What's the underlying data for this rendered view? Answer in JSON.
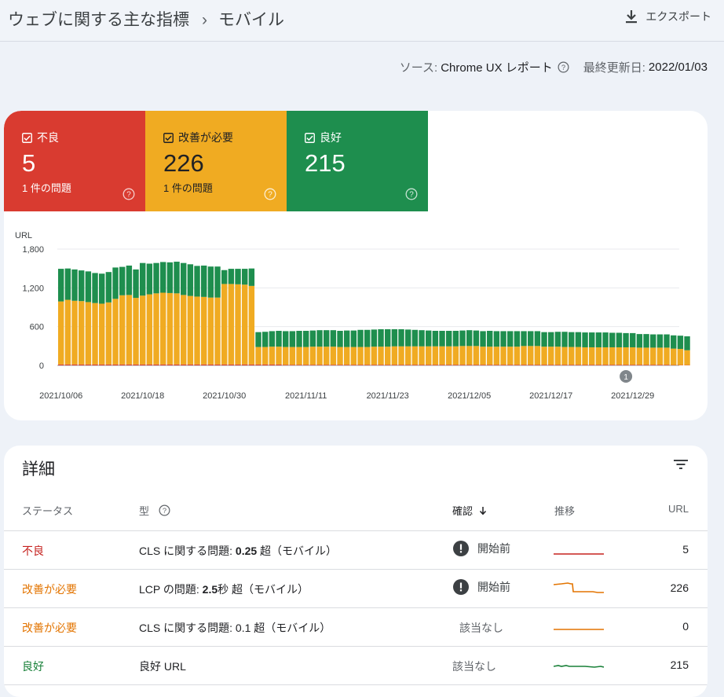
{
  "breadcrumb": {
    "parent": "ウェブに関する主な指標",
    "separator": "›",
    "current": "モバイル"
  },
  "export_label": "エクスポート",
  "source": {
    "label": "ソース:",
    "value": "Chrome UX レポート",
    "updated_label": "最終更新日:",
    "updated_value": "2022/01/03"
  },
  "tiles": [
    {
      "label": "不良",
      "count": "5",
      "sub": "1 件の問題",
      "color": "#d93b30"
    },
    {
      "label": "改善が必要",
      "count": "226",
      "sub": "1 件の問題",
      "color": "#f0ab22"
    },
    {
      "label": "良好",
      "count": "215",
      "sub": "",
      "color": "#1e8e4e"
    }
  ],
  "chart_data": {
    "type": "bar",
    "stacked": true,
    "ylabel": "URL",
    "ylim": [
      0,
      1800
    ],
    "y_ticks": [
      "1,800",
      "1,200",
      "600",
      "0"
    ],
    "x_tick_labels": [
      "2021/10/06",
      "2021/10/18",
      "2021/10/30",
      "2021/11/11",
      "2021/11/23",
      "2021/12/05",
      "2021/12/17",
      "2021/12/29"
    ],
    "annotation": "1",
    "x_start": "2021/10/06",
    "colors": {
      "poor": "#d93b30",
      "ni": "#f0ab22",
      "good": "#1e8e4e"
    },
    "series": [
      {
        "name": "不良",
        "values": [
          15,
          15,
          15,
          15,
          15,
          15,
          15,
          15,
          15,
          15,
          15,
          15,
          15,
          15,
          15,
          15,
          15,
          15,
          15,
          15,
          15,
          15,
          15,
          15,
          15,
          15,
          15,
          15,
          15,
          15,
          15,
          15,
          15,
          10,
          10,
          10,
          10,
          10,
          10,
          10,
          10,
          10,
          10,
          10,
          10,
          10,
          10,
          10,
          10,
          10,
          10,
          10,
          10,
          10,
          10,
          10,
          10,
          10,
          10,
          10,
          10,
          10,
          10,
          10,
          10,
          10,
          10,
          10,
          10,
          10,
          10,
          10,
          10,
          10,
          10,
          10,
          10,
          10,
          10,
          10,
          10,
          10,
          10,
          10,
          10,
          10,
          10,
          10,
          10,
          10,
          5,
          5,
          5
        ]
      },
      {
        "name": "改善が必要",
        "values": [
          975,
          1000,
          985,
          980,
          965,
          950,
          940,
          960,
          1015,
          1070,
          1075,
          1030,
          1065,
          1085,
          1100,
          1110,
          1105,
          1100,
          1075,
          1060,
          1050,
          1045,
          1035,
          1035,
          1245,
          1245,
          1240,
          1235,
          1215,
          270,
          270,
          275,
          275,
          275,
          275,
          275,
          275,
          280,
          280,
          280,
          280,
          275,
          275,
          275,
          275,
          275,
          280,
          280,
          280,
          285,
          285,
          285,
          285,
          285,
          285,
          285,
          285,
          285,
          285,
          290,
          290,
          290,
          280,
          280,
          280,
          280,
          280,
          280,
          290,
          290,
          290,
          280,
          280,
          280,
          275,
          275,
          275,
          270,
          270,
          270,
          270,
          270,
          270,
          270,
          270,
          265,
          265,
          265,
          265,
          265,
          255,
          250,
          230
        ]
      },
      {
        "name": "良好",
        "values": [
          505,
          485,
          485,
          475,
          475,
          465,
          465,
          470,
          485,
          440,
          455,
          440,
          505,
          475,
          470,
          475,
          475,
          490,
          495,
          490,
          475,
          485,
          480,
          480,
          215,
          235,
          240,
          245,
          270,
          230,
          235,
          240,
          245,
          245,
          245,
          250,
          250,
          250,
          255,
          255,
          255,
          250,
          255,
          255,
          265,
          265,
          265,
          270,
          270,
          265,
          265,
          260,
          255,
          250,
          245,
          240,
          240,
          240,
          240,
          240,
          245,
          240,
          240,
          245,
          240,
          240,
          240,
          240,
          230,
          230,
          230,
          225,
          225,
          230,
          235,
          230,
          230,
          230,
          230,
          230,
          230,
          225,
          225,
          220,
          220,
          210,
          210,
          205,
          205,
          205,
          205,
          205,
          215
        ]
      }
    ]
  },
  "details": {
    "title": "詳細",
    "columns": {
      "status": "ステータス",
      "type": "型",
      "confirm": "確認",
      "trend": "推移",
      "url": "URL"
    },
    "rows": [
      {
        "status": "不良",
        "type_pre": "CLS に関する問題: ",
        "type_b": "0.25",
        "type_post": " 超（モバイル）",
        "confirm": "開始前",
        "url": "5"
      },
      {
        "status": "改善が必要",
        "type_pre": "LCP の問題: ",
        "type_b": "2.5",
        "type_post": "秒 超（モバイル）",
        "confirm": "開始前",
        "url": "226"
      },
      {
        "status": "改善が必要",
        "type_pre": "CLS に関する問題: 0.1 超（モバイル）",
        "type_b": "",
        "type_post": "",
        "confirm": "該当なし",
        "url": "0"
      },
      {
        "status": "良好",
        "type_pre": "良好 URL",
        "type_b": "",
        "type_post": "",
        "confirm": "該当なし",
        "url": "215"
      }
    ]
  }
}
